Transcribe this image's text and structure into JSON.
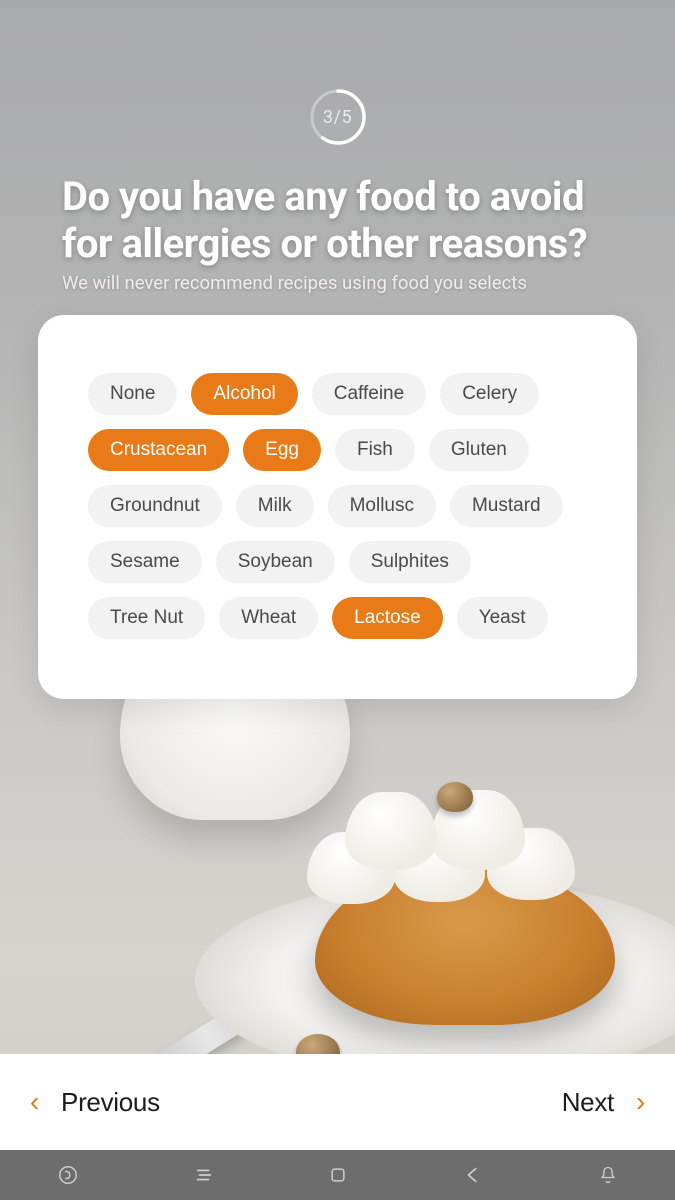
{
  "progress": {
    "current": 3,
    "total": 5,
    "label": "3/5"
  },
  "heading": "Do you have any food to avoid for allergies or other reasons?",
  "subheading": "We will never recommend recipes using food you selects",
  "chips": [
    {
      "label": "None",
      "selected": false
    },
    {
      "label": "Alcohol",
      "selected": true
    },
    {
      "label": "Caffeine",
      "selected": false
    },
    {
      "label": "Celery",
      "selected": false
    },
    {
      "label": "Crustacean",
      "selected": true
    },
    {
      "label": "Egg",
      "selected": true
    },
    {
      "label": "Fish",
      "selected": false
    },
    {
      "label": "Gluten",
      "selected": false
    },
    {
      "label": "Groundnut",
      "selected": false
    },
    {
      "label": "Milk",
      "selected": false
    },
    {
      "label": "Mollusc",
      "selected": false
    },
    {
      "label": "Mustard",
      "selected": false
    },
    {
      "label": "Sesame",
      "selected": false
    },
    {
      "label": "Soybean",
      "selected": false
    },
    {
      "label": "Sulphites",
      "selected": false
    },
    {
      "label": "Tree Nut",
      "selected": false
    },
    {
      "label": "Wheat",
      "selected": false
    },
    {
      "label": "Lactose",
      "selected": true
    },
    {
      "label": "Yeast",
      "selected": false
    }
  ],
  "footer": {
    "previous": "Previous",
    "next": "Next"
  },
  "colors": {
    "accent": "#e87a17"
  }
}
